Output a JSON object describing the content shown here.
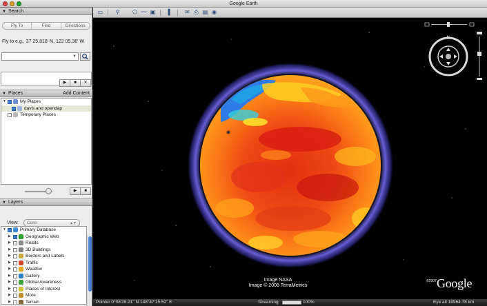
{
  "window": {
    "title": "Google Earth"
  },
  "search_panel": {
    "header": "Search",
    "tabs": [
      "Fly To",
      "Find Businesses",
      "Directions"
    ],
    "fly_to_label": "Fly to e.g., 37 25.818' N, 122 05.36' W",
    "fly_to_value": ""
  },
  "playback": {
    "play": "▶",
    "stop": "■",
    "close": "✕"
  },
  "places_panel": {
    "header": "Places",
    "add_content": "Add Content",
    "items": [
      {
        "label": "My Places",
        "checked": true,
        "expanded": true,
        "selected": false
      },
      {
        "label": "davis and opendap",
        "checked": true,
        "expanded": false,
        "selected": true
      },
      {
        "label": "Temporary Places",
        "checked": false,
        "expanded": false,
        "selected": false
      }
    ]
  },
  "layers_panel": {
    "header": "Layers",
    "view_label": "View:",
    "view_value": "Core",
    "items": [
      {
        "label": "Primary Database",
        "checked": true,
        "icon": "globe-icon",
        "color": "#3b8bd6"
      },
      {
        "label": "Geographic Web",
        "checked": true,
        "icon": "star-icon",
        "color": "#2aa12a"
      },
      {
        "label": "Roads",
        "checked": false,
        "icon": "road-icon",
        "color": "#888888"
      },
      {
        "label": "3D Buildings",
        "checked": false,
        "icon": "building-icon",
        "color": "#7f7f7f"
      },
      {
        "label": "Borders and Labels",
        "checked": false,
        "icon": "border-icon",
        "color": "#c9a640"
      },
      {
        "label": "Traffic",
        "checked": false,
        "icon": "traffic-icon",
        "color": "#d24a2a"
      },
      {
        "label": "Weather",
        "checked": false,
        "icon": "weather-icon",
        "color": "#e4a51a"
      },
      {
        "label": "Gallery",
        "checked": false,
        "icon": "gallery-icon",
        "color": "#2f7cc9"
      },
      {
        "label": "Global Awareness",
        "checked": false,
        "icon": "awareness-icon",
        "color": "#3aa63a"
      },
      {
        "label": "Places of Interest",
        "checked": false,
        "icon": "poi-icon",
        "color": "#d1c23a"
      },
      {
        "label": "More",
        "checked": false,
        "icon": "folder-icon",
        "color": "#c08f32"
      },
      {
        "label": "Terrain",
        "checked": false,
        "icon": "terrain-icon",
        "color": "#8a6a3a"
      }
    ]
  },
  "toolbar": {
    "buttons": [
      "sidebar-icon",
      "placemark-icon",
      "polygon-icon",
      "path-icon",
      "overlay-icon",
      "ruler-icon",
      "email-icon",
      "print-icon",
      "maps-icon",
      "sky-icon"
    ]
  },
  "view": {
    "credits_line1": "Image NASA",
    "credits_line2": "Image © 2008 TerraMetrics",
    "logo_year": "©2007",
    "logo": "Google"
  },
  "status": {
    "pointer": "Pointer  0°08'26.21\" N   148°47'15.52\" E",
    "streaming": "Streaming",
    "streaming_percent": "100%",
    "streaming_progress": 1.0,
    "eye_alt": "Eye alt  18964.78 km"
  },
  "colors": {
    "accent": "#3c7fd1",
    "atmosphere": "#6b63e0",
    "heat_hot": "#e62a12",
    "heat_cold": "#2f7be6"
  }
}
